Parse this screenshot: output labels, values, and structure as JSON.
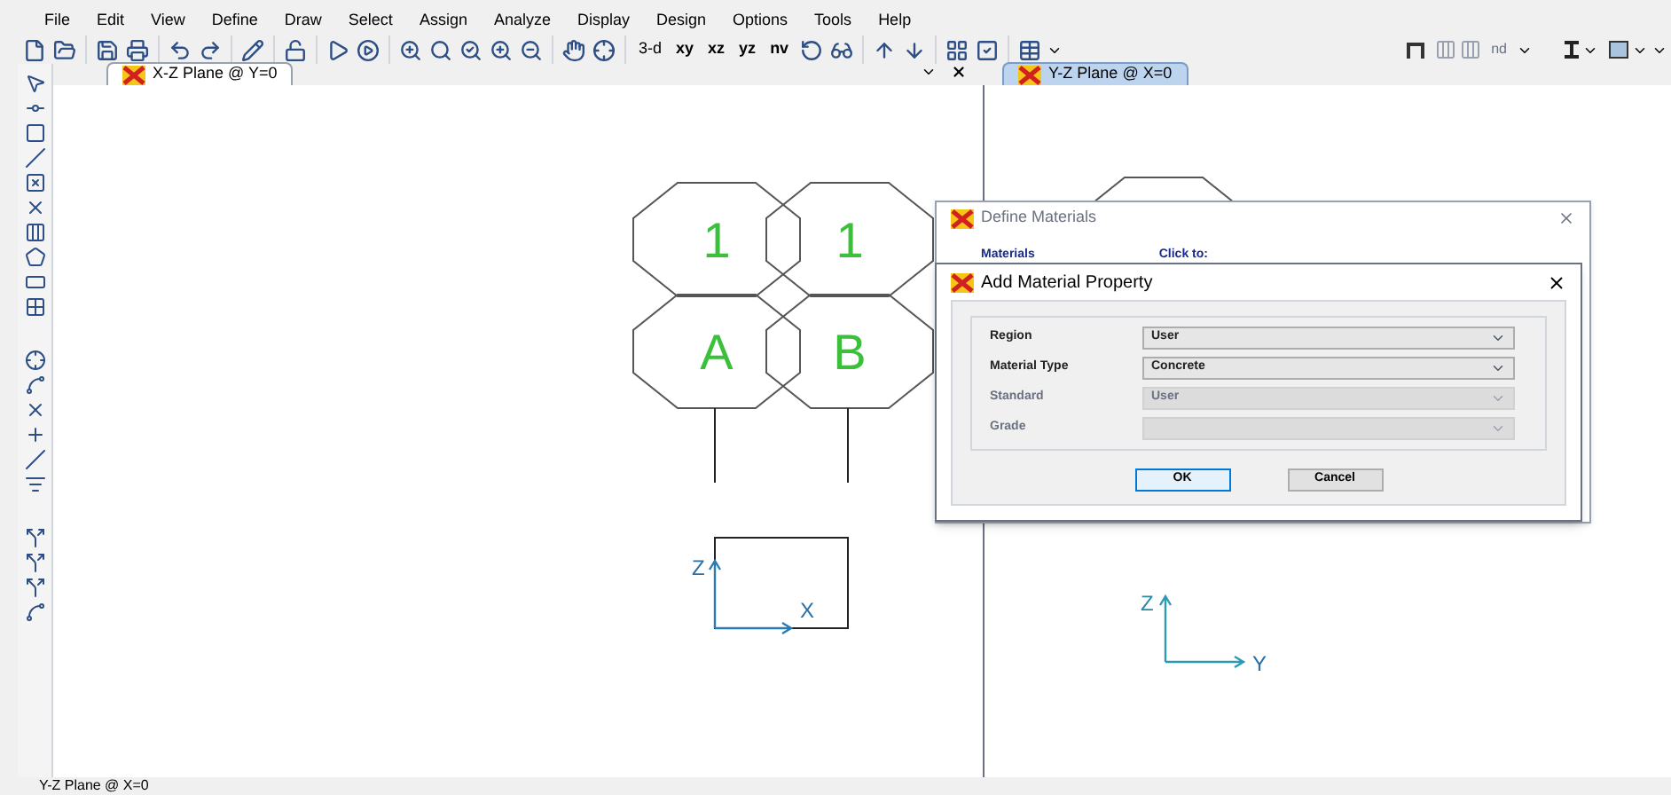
{
  "menu": [
    "File",
    "Edit",
    "View",
    "Define",
    "Draw",
    "Select",
    "Assign",
    "Analyze",
    "Display",
    "Design",
    "Options",
    "Tools",
    "Help"
  ],
  "toolbar": {
    "view_buttons": [
      "3-d",
      "xy",
      "xz",
      "yz",
      "nv"
    ],
    "section_label": "nd"
  },
  "views": [
    {
      "tab": "X-Z Plane @ Y=0",
      "selected": false,
      "bubbles": [
        "1",
        "1",
        "A",
        "B"
      ],
      "axes": [
        "Z",
        "X"
      ]
    },
    {
      "tab": "Y-Z Plane @ X=0",
      "selected": true,
      "axes": [
        "Z",
        "Y"
      ]
    }
  ],
  "define_materials": {
    "title": "Define Materials",
    "groups": [
      "Materials",
      "Click to:"
    ]
  },
  "add_material": {
    "title": "Add Material Property",
    "fields": [
      {
        "label": "Region",
        "value": "User",
        "disabled": false
      },
      {
        "label": "Material Type",
        "value": "Concrete",
        "disabled": false
      },
      {
        "label": "Standard",
        "value": "User",
        "disabled": true
      },
      {
        "label": "Grade",
        "disabled": true
      }
    ],
    "buttons": [
      "OK",
      "Cancel"
    ]
  },
  "status_bar": "Y-Z Plane @ X=0"
}
